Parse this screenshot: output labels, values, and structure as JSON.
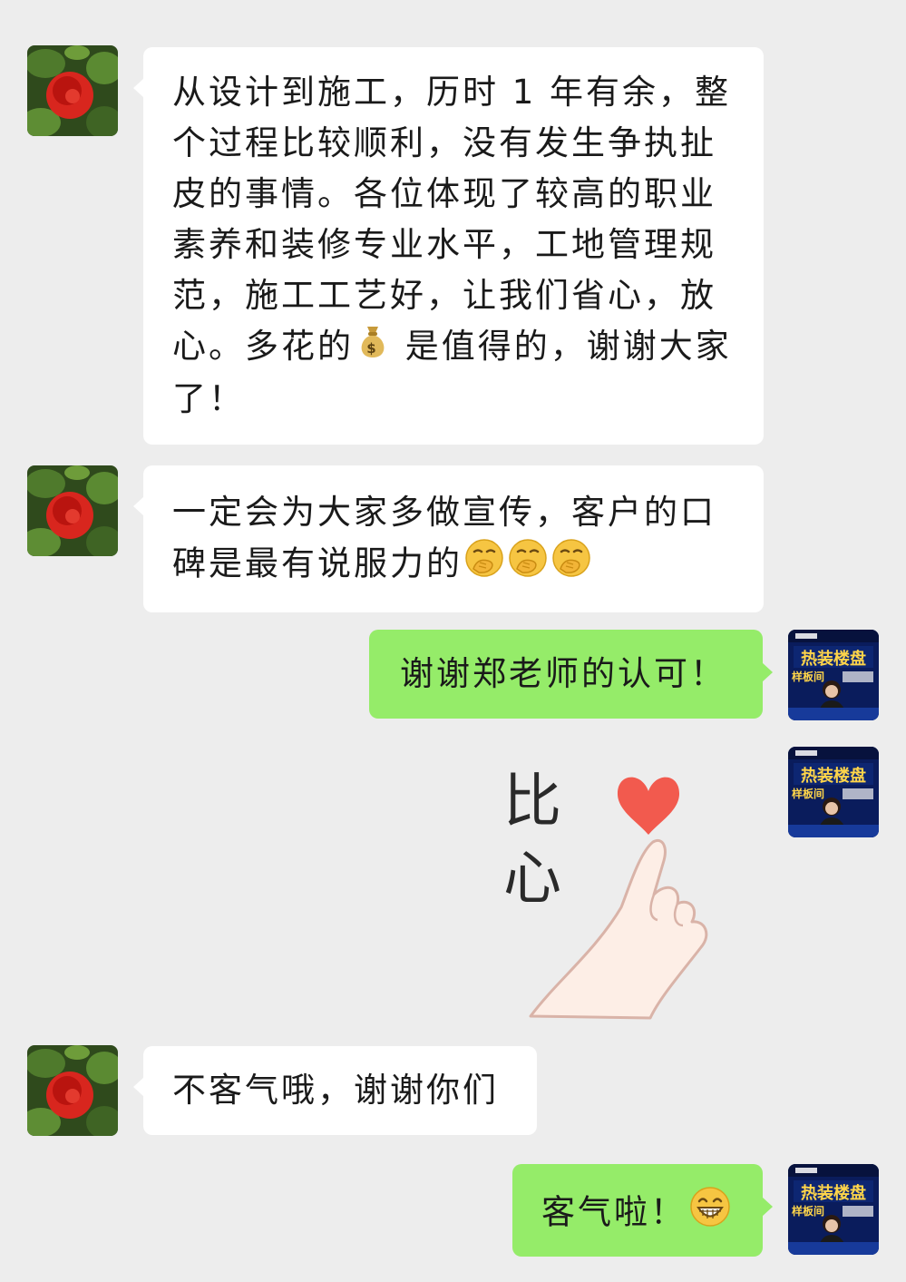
{
  "chat": {
    "messages": [
      {
        "sender": "other",
        "text_before": "从设计到施工，历时 1 年有余，整个过程比较顺利，没有发生争执扯皮的事情。各位体现了较高的职业素养和装修专业水平，工地管理规范，施工工艺好，让我们省心，放心。多花的",
        "emoji": "money-bag",
        "text_after": " 是值得的，谢谢大家了！"
      },
      {
        "sender": "other",
        "text": "一定会为大家多做宣传，客户的口碑是最有说服力的",
        "emojis": [
          "hand-over-mouth",
          "hand-over-mouth",
          "hand-over-mouth"
        ]
      },
      {
        "sender": "self",
        "text": "谢谢郑老师的认可！"
      },
      {
        "sender": "self",
        "sticker": {
          "name": "finger-heart-sticker",
          "text_line1": "比",
          "text_line2": "心"
        }
      },
      {
        "sender": "other",
        "text": "不客气哦，谢谢你们"
      },
      {
        "sender": "self",
        "text": "客气啦！",
        "emoji": "grinning-face"
      }
    ],
    "self_avatar": {
      "banner_line1": "热装楼盘",
      "banner_line2": "样板间"
    }
  },
  "colors": {
    "background": "#ededed",
    "bubble_other": "#ffffff",
    "bubble_self": "#95ec69",
    "heart": "#f25a4e"
  }
}
